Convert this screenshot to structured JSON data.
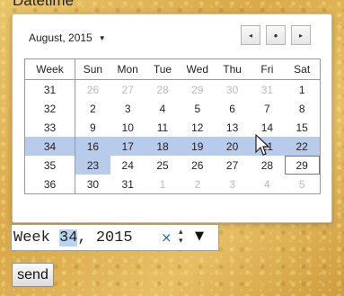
{
  "field_label": "Datetime",
  "calendar": {
    "month_label": "August, 2015",
    "nav": [
      "◂",
      "●",
      "▸"
    ],
    "headers": [
      "Week",
      "Sun",
      "Mon",
      "Tue",
      "Wed",
      "Thu",
      "Fri",
      "Sat"
    ],
    "weeks": [
      {
        "week": "31",
        "days": [
          [
            "26",
            1
          ],
          [
            "27",
            1
          ],
          [
            "28",
            1
          ],
          [
            "29",
            1
          ],
          [
            "30",
            1
          ],
          [
            "31",
            1
          ],
          [
            "1",
            0
          ]
        ]
      },
      {
        "week": "32",
        "days": [
          [
            "2",
            0
          ],
          [
            "3",
            0
          ],
          [
            "4",
            0
          ],
          [
            "5",
            0
          ],
          [
            "6",
            0
          ],
          [
            "7",
            0
          ],
          [
            "8",
            0
          ]
        ]
      },
      {
        "week": "33",
        "days": [
          [
            "9",
            0
          ],
          [
            "10",
            0
          ],
          [
            "11",
            0
          ],
          [
            "12",
            0
          ],
          [
            "13",
            0
          ],
          [
            "14",
            0
          ],
          [
            "15",
            0
          ]
        ]
      },
      {
        "week": "34",
        "days": [
          [
            "16",
            0
          ],
          [
            "17",
            0
          ],
          [
            "18",
            0
          ],
          [
            "19",
            0
          ],
          [
            "20",
            0
          ],
          [
            "21",
            0
          ],
          [
            "22",
            0
          ]
        ],
        "selected": true
      },
      {
        "week": "35",
        "days": [
          [
            "23",
            0
          ],
          [
            "24",
            0
          ],
          [
            "25",
            0
          ],
          [
            "26",
            0
          ],
          [
            "27",
            0
          ],
          [
            "28",
            0
          ],
          [
            "29",
            0
          ]
        ]
      },
      {
        "week": "36",
        "days": [
          [
            "30",
            0
          ],
          [
            "31",
            0
          ],
          [
            "1",
            1
          ],
          [
            "2",
            1
          ],
          [
            "3",
            1
          ],
          [
            "4",
            1
          ],
          [
            "5",
            1
          ]
        ]
      }
    ],
    "today": "23",
    "boxed": "29"
  },
  "input": {
    "prefix": "Week ",
    "week_value": "34",
    "suffix": ", 2015",
    "clear_icon": "×",
    "spin_icon": "▴▾",
    "dropdown_icon": "▼"
  },
  "send_label": "send"
}
